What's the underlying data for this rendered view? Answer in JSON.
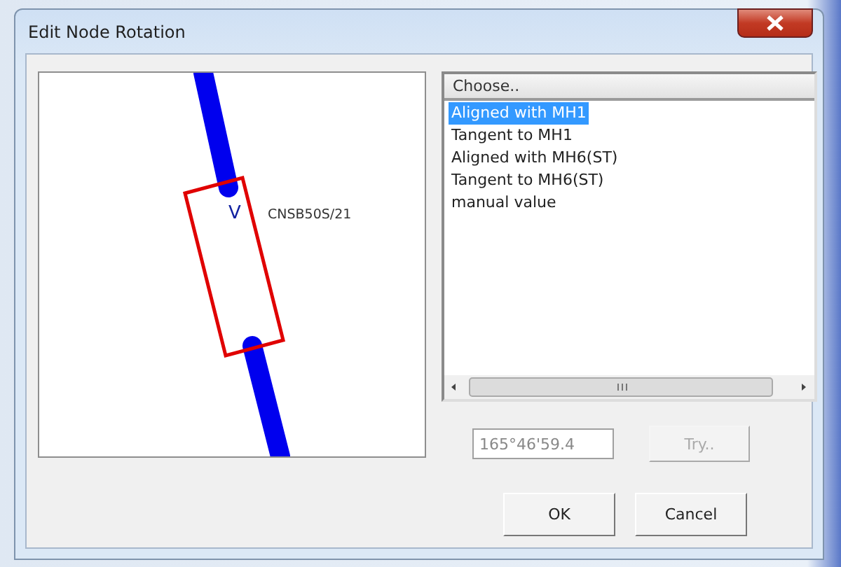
{
  "window": {
    "title": "Edit Node Rotation"
  },
  "diagram": {
    "node_label": "CNSB50S/21",
    "node_symbol": "V"
  },
  "list": {
    "header": "Choose..",
    "items": [
      {
        "label": "Aligned with MH1",
        "selected": true
      },
      {
        "label": "Tangent to MH1",
        "selected": false
      },
      {
        "label": "Aligned with MH6(ST)",
        "selected": false
      },
      {
        "label": "Tangent to MH6(ST)",
        "selected": false
      },
      {
        "label": "manual value",
        "selected": false
      }
    ]
  },
  "angle_field": {
    "value": "165°46'59.4",
    "disabled": true
  },
  "try_button": {
    "label": "Try..",
    "disabled": true
  },
  "buttons": [
    {
      "label": "OK"
    },
    {
      "label": "Cancel"
    }
  ]
}
